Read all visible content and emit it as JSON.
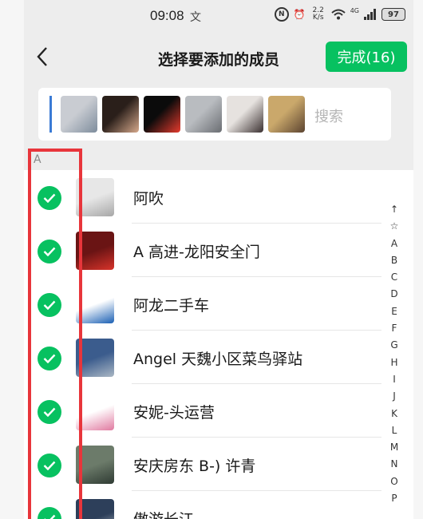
{
  "status_bar": {
    "time": "09:08",
    "time_glyph": "文",
    "icons": {
      "nfc": "N",
      "alarm": "⏰",
      "speed_value": "2.2",
      "speed_unit": "K/s",
      "wifi": "wifi-icon",
      "network": "4G",
      "battery": "97"
    }
  },
  "header": {
    "back_icon": "chevron-left-icon",
    "title": "选择要添加的成员",
    "done_label": "完成(16)"
  },
  "selected": {
    "search_placeholder": "搜索",
    "avatars": [
      {
        "colors": [
          "#c9ccd2",
          "#7d8c9c"
        ]
      },
      {
        "colors": [
          "#2a1f1a",
          "#d7a98c"
        ]
      },
      {
        "colors": [
          "#0b0b0b",
          "#e63b2e"
        ]
      },
      {
        "colors": [
          "#b9bcc0",
          "#6a6d72"
        ]
      },
      {
        "colors": [
          "#e6e2df",
          "#3a3030"
        ]
      },
      {
        "colors": [
          "#caa86b",
          "#5b4330"
        ]
      }
    ]
  },
  "section": {
    "letter": "A"
  },
  "contacts": [
    {
      "name": "阿吹",
      "checked": true,
      "colors": [
        "#e7e7e7",
        "#a7a7a7"
      ]
    },
    {
      "name": "A 高进-龙阳安全门",
      "checked": true,
      "colors": [
        "#6a1414",
        "#d8332a"
      ]
    },
    {
      "name": "阿龙二手车",
      "checked": true,
      "colors": [
        "#ffffff",
        "#1a5fb4"
      ]
    },
    {
      "name": "Angel 天魏小区菜鸟驿站",
      "checked": true,
      "colors": [
        "#3b5c8d",
        "#aab7c4"
      ]
    },
    {
      "name": "安妮-头运营",
      "checked": true,
      "colors": [
        "#ffffff",
        "#e07aa0"
      ]
    },
    {
      "name": "安庆房东 B-) 许青",
      "checked": true,
      "colors": [
        "#6c7b6a",
        "#2f3b33"
      ]
    },
    {
      "name": "傲游长江",
      "checked": true,
      "colors": [
        "#2d3f5a",
        "#c0c7d0"
      ]
    }
  ],
  "index_bar": [
    "↑",
    "☆",
    "A",
    "B",
    "C",
    "D",
    "E",
    "F",
    "G",
    "H",
    "I",
    "J",
    "K",
    "L",
    "M",
    "N",
    "O",
    "P"
  ],
  "colors": {
    "accent": "#07c160",
    "annotation": "#e8353b",
    "background": "#ededed"
  }
}
